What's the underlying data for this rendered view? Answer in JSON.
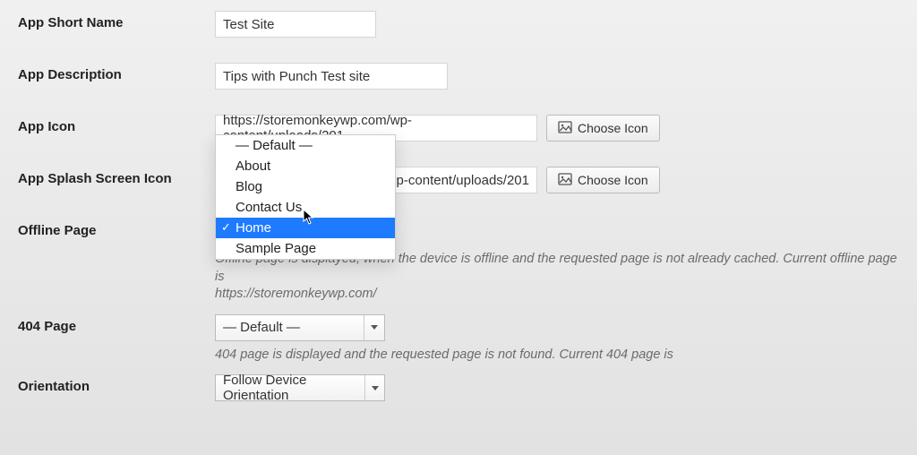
{
  "fields": {
    "app_short_name": {
      "label": "App Short Name",
      "value": "Test Site"
    },
    "app_description": {
      "label": "App Description",
      "value": "Tips with Punch Test site"
    },
    "app_icon": {
      "label": "App Icon",
      "value": "https://storemonkeywp.com/wp-content/uploads/201",
      "button": "Choose Icon"
    },
    "app_splash": {
      "label": "App Splash Screen Icon",
      "value_fragment": "p-content/uploads/201",
      "button": "Choose Icon"
    },
    "offline_page": {
      "label": "Offline Page",
      "help_prefix": "Offline page is displayed, when the device is offline and the requested page is not already cached. Current offline page is",
      "help_url": "https://storemonkeywp.com/",
      "options": [
        "— Default —",
        "About",
        "Blog",
        "Contact Us",
        "Home",
        "Sample Page"
      ],
      "selected": "Home"
    },
    "page_404": {
      "label": "404 Page",
      "value": "— Default —",
      "help": "404 page is displayed and the requested page is not found. Current 404 page is"
    },
    "orientation": {
      "label": "Orientation",
      "value": "Follow Device Orientation"
    }
  }
}
